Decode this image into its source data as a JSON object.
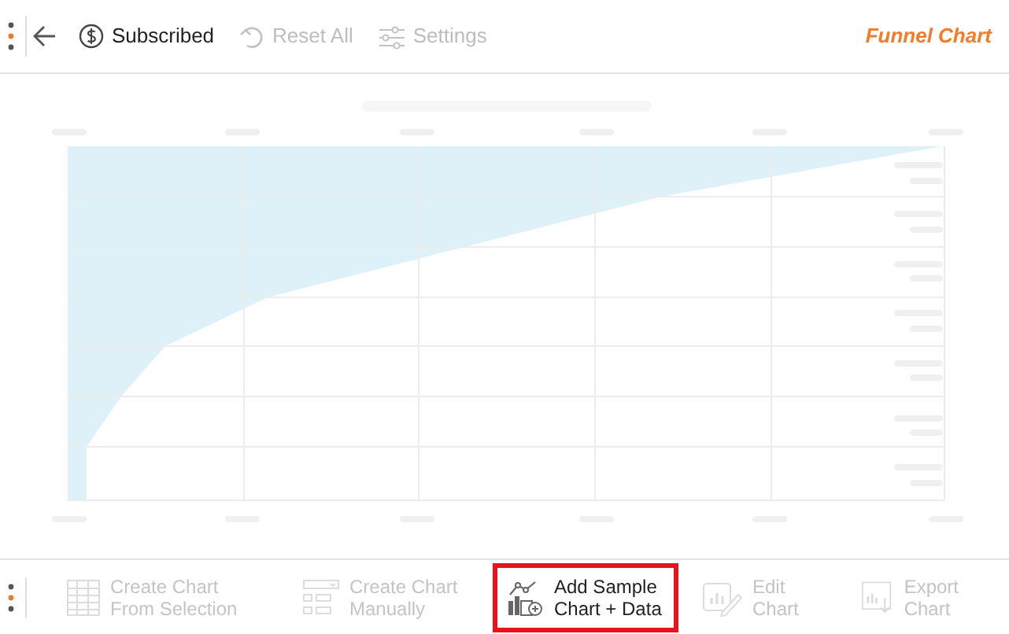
{
  "top_toolbar": [
    {
      "kind": "subscription",
      "label": "Subscribed",
      "disabled": false
    },
    {
      "kind": "reset",
      "label": "Reset All",
      "disabled": true
    },
    {
      "kind": "settings",
      "label": "Settings",
      "disabled": true
    }
  ],
  "title": "Funnel Chart",
  "bottom_toolbar": [
    {
      "kind": "table",
      "label": "Create Chart\nFrom Selection",
      "disabled": true,
      "highlighted": false
    },
    {
      "kind": "form",
      "label": "Create Chart\nManually",
      "disabled": true,
      "highlighted": false
    },
    {
      "kind": "sample",
      "label": "Add Sample\nChart + Data",
      "disabled": false,
      "highlighted": true
    },
    {
      "kind": "edit",
      "label": "Edit\nChart",
      "disabled": true,
      "highlighted": false
    },
    {
      "kind": "export",
      "label": "Export\nChart",
      "disabled": true,
      "highlighted": false
    }
  ]
}
